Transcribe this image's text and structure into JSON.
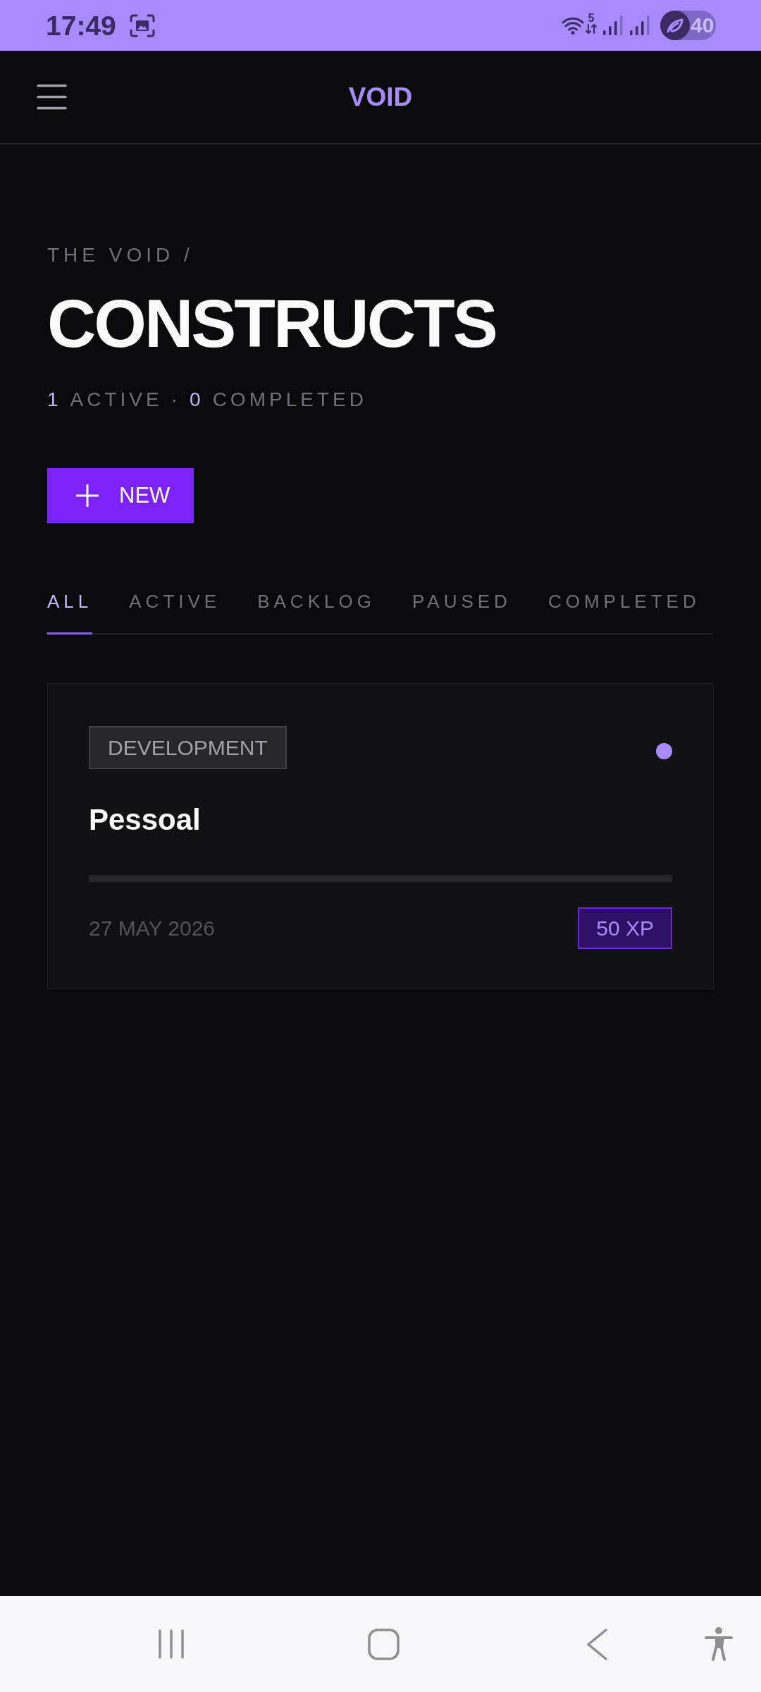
{
  "status_bar": {
    "time": "17:49",
    "network_type": "5",
    "battery": "40"
  },
  "app_bar": {
    "title": "VOID"
  },
  "header": {
    "breadcrumb": "THE VOID /",
    "title": "CONSTRUCTS",
    "stats": [
      {
        "count": "1",
        "label": "ACTIVE"
      },
      {
        "count": "0",
        "label": "COMPLETED"
      }
    ],
    "stats_separator": "·"
  },
  "new_button": {
    "label": "NEW"
  },
  "tabs": [
    {
      "label": "ALL",
      "selected": true
    },
    {
      "label": "ACTIVE",
      "selected": false
    },
    {
      "label": "BACKLOG",
      "selected": false
    },
    {
      "label": "PAUSED",
      "selected": false
    },
    {
      "label": "COMPLETED",
      "selected": false
    }
  ],
  "cards": [
    {
      "tag": "DEVELOPMENT",
      "title": "Pessoal",
      "color": "#a78bfa",
      "date": "27 MAY 2026",
      "xp": "50 XP"
    }
  ]
}
